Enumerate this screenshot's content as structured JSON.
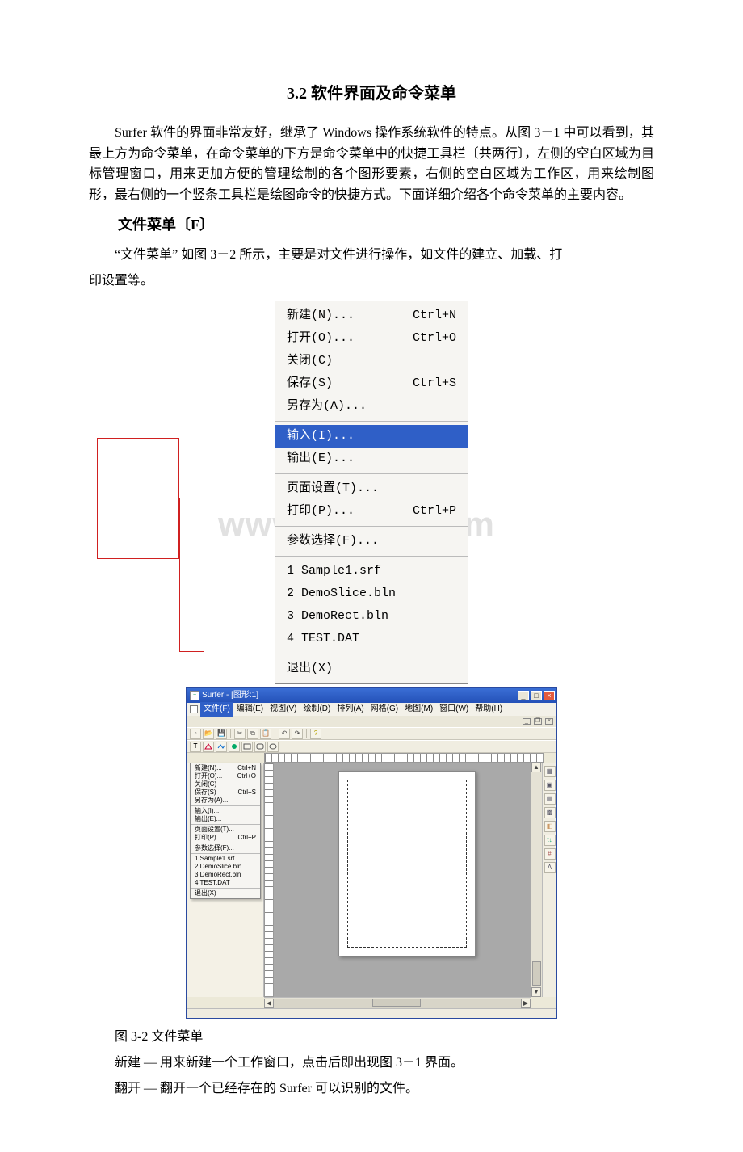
{
  "title": "3.2 软件界面及命令菜单",
  "paras": {
    "p1": "Surfer 软件的界面非常友好，继承了 Windows 操作系统软件的特点。从图 3－1 中可以看到，其最上方为命令菜单，在命令菜单的下方是命令菜单中的快捷工具栏〔共两行〕，左侧的空白区域为目标管理窗口，用来更加方便的管理绘制的各个图形要素，右侧的空白区域为工作区，用来绘制图形，最右侧的一个竖条工具栏是绘图命令的快捷方式。下面详细介绍各个命令菜单的主要内容。",
    "h2": "文件菜单〔F〕",
    "p2a": "“文件菜单” 如图 3－2 所示，主要是对文件进行操作，如文件的建立、加载、打",
    "p2b": "印设置等。",
    "caption": "图 3-2 文件菜单",
    "p3": "新建 — 用来新建一个工作窗口，点击后即出现图 3－1 界面。",
    "p4": "翻开  — 翻开一个已经存在的 Surfer 可以识别的文件。"
  },
  "watermark": "www.bdocx.com",
  "big_menu": {
    "g1": [
      {
        "label": "新建(N)...",
        "shortcut": "Ctrl+N"
      },
      {
        "label": "打开(O)...",
        "shortcut": "Ctrl+O"
      },
      {
        "label": "关闭(C)",
        "shortcut": ""
      },
      {
        "label": "保存(S)",
        "shortcut": "Ctrl+S"
      },
      {
        "label": "另存为(A)...",
        "shortcut": ""
      }
    ],
    "g2": [
      {
        "label": "输入(I)...",
        "shortcut": "",
        "selected": true
      },
      {
        "label": "输出(E)...",
        "shortcut": ""
      }
    ],
    "g3": [
      {
        "label": "页面设置(T)...",
        "shortcut": ""
      },
      {
        "label": "打印(P)...",
        "shortcut": "Ctrl+P"
      }
    ],
    "g4": [
      {
        "label": "参数选择(F)...",
        "shortcut": ""
      }
    ],
    "g5": [
      {
        "label": "1 Sample1.srf",
        "shortcut": ""
      },
      {
        "label": "2 DemoSlice.bln",
        "shortcut": ""
      },
      {
        "label": "3 DemoRect.bln",
        "shortcut": ""
      },
      {
        "label": "4 TEST.DAT",
        "shortcut": ""
      }
    ],
    "g6": [
      {
        "label": "退出(X)",
        "shortcut": ""
      }
    ]
  },
  "app": {
    "title": "Surfer - [图形:1]",
    "menubar": [
      "文件(F)",
      "编辑(E)",
      "视图(V)",
      "绘制(D)",
      "排列(A)",
      "网格(G)",
      "地图(M)",
      "窗口(W)",
      "帮助(H)"
    ],
    "small_menu": {
      "g1": [
        {
          "label": "新建(N)...",
          "sc": "Ctrl+N"
        },
        {
          "label": "打开(O)...",
          "sc": "Ctrl+O"
        },
        {
          "label": "关闭(C)",
          "sc": ""
        },
        {
          "label": "保存(S)",
          "sc": "Ctrl+S"
        },
        {
          "label": "另存为(A)...",
          "sc": ""
        }
      ],
      "g2": [
        {
          "label": "输入(I)...",
          "sc": ""
        },
        {
          "label": "输出(E)...",
          "sc": ""
        }
      ],
      "g3": [
        {
          "label": "页面设置(T)...",
          "sc": ""
        },
        {
          "label": "打印(P)...",
          "sc": "Ctrl+P"
        }
      ],
      "g4": [
        {
          "label": "参数选择(F)...",
          "sc": ""
        }
      ],
      "g5": [
        {
          "label": "1 Sample1.srf",
          "sc": ""
        },
        {
          "label": "2 DemoSlice.bln",
          "sc": ""
        },
        {
          "label": "3 DemoRect.bln",
          "sc": ""
        },
        {
          "label": "4 TEST.DAT",
          "sc": ""
        }
      ],
      "g6": [
        {
          "label": "退出(X)",
          "sc": ""
        }
      ]
    }
  }
}
